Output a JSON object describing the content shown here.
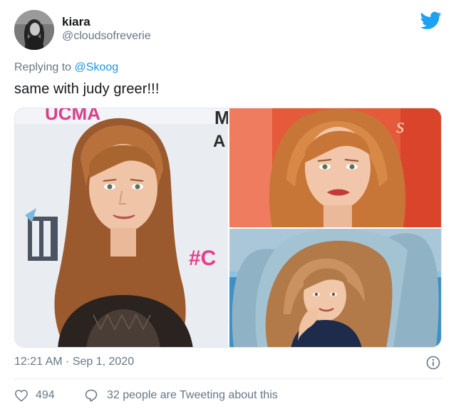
{
  "author": {
    "name": "kiara",
    "handle": "@cloudsofreverie"
  },
  "reply_to": {
    "prefix": "Replying to ",
    "mention": "@Skoog"
  },
  "tweet_text": "same with judy greer!!!",
  "backdrop_text": {
    "top_left": "UCMA",
    "top_mid": "M",
    "mid_left": "A",
    "hashtag": "#C",
    "right_logo": "s"
  },
  "timestamp": "12:21 AM · Sep 1, 2020",
  "likes": "494",
  "replies": "32 people are Tweeting about this",
  "colors": {
    "brand_blue": "#1da1f2",
    "text_primary": "#14171a",
    "text_secondary": "#657786",
    "link": "#1b95e0",
    "hashtag_pink": "#e83d8a"
  },
  "icons": {
    "logo": "twitter-bird-icon",
    "info": "info-icon",
    "like": "heart-icon",
    "reply": "speech-bubble-icon"
  }
}
